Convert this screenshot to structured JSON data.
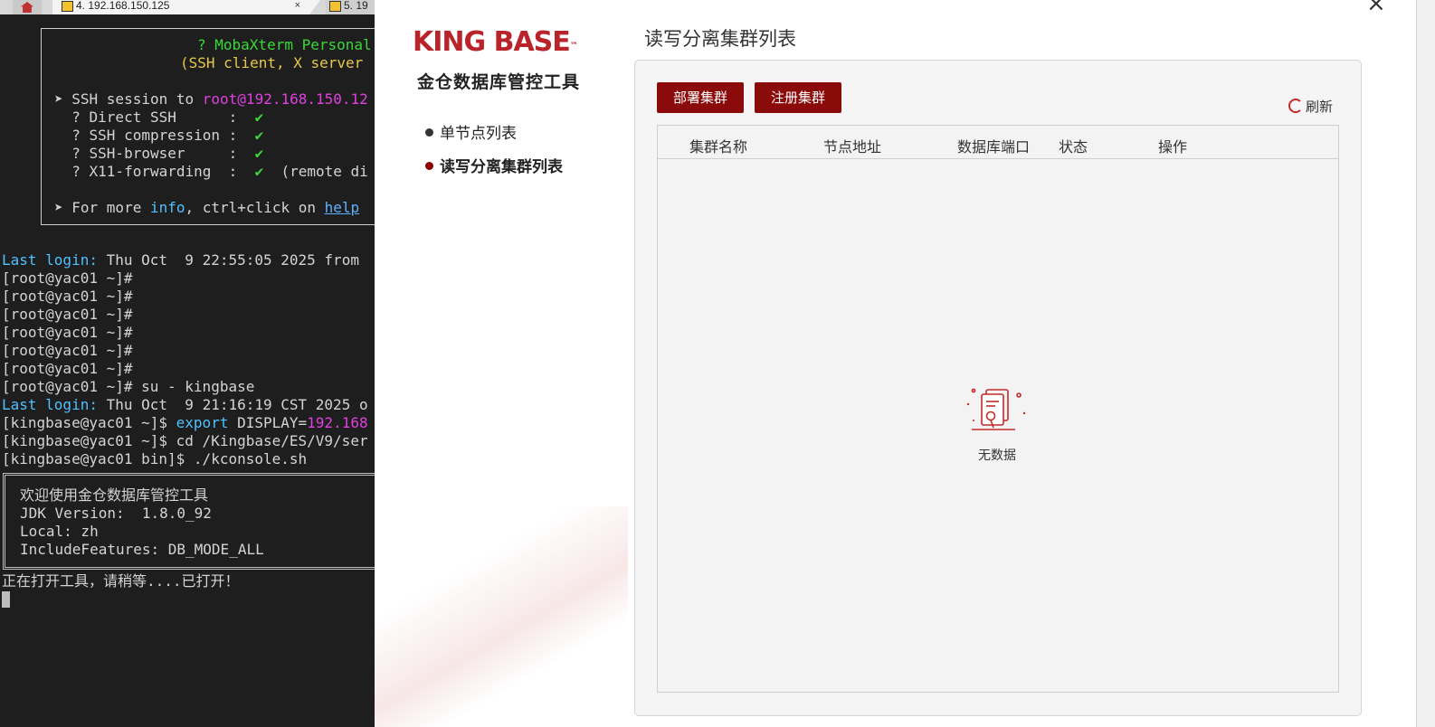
{
  "tabs": {
    "tab4_label": "4. 192.168.150.125",
    "tab5_label": "5. 19",
    "close_glyph": "×"
  },
  "terminal": {
    "welcome": {
      "line1": "? MobaXterm Personal",
      "line2": "(SSH client, X server",
      "ssh_prefix": "➤ SSH session to ",
      "ssh_host": "root@192.168.150.12",
      "direct_ssh": "  ? Direct SSH      :  ",
      "compression": "  ? SSH compression :  ",
      "browser": "  ? SSH-browser     :  ",
      "x11": "  ? X11-forwarding  :  ",
      "check": "✔",
      "x11_suffix": "  (remote di",
      "info_prefix": "➤ For more ",
      "info_word": "info",
      "info_mid": ", ctrl+click on ",
      "help_word": "help"
    },
    "last_login1_label": "Last login:",
    "last_login1_rest": " Thu Oct  9 22:55:05 2025 from",
    "prompt_root": "[root@yac01 ~]#",
    "su_cmd": "[root@yac01 ~]# su - kingbase",
    "last_login2_label": "Last login:",
    "last_login2_rest": " Thu Oct  9 21:16:19 CST 2025 o",
    "kb_prompt": "[kingbase@yac01 ~]$ ",
    "export_kw": "export",
    "export_var": " DISPLAY=",
    "export_val": "192.168",
    "cd_cmd": "[kingbase@yac01 ~]$ cd /Kingbase/ES/V9/ser",
    "run_cmd": "[kingbase@yac01 bin]$ ./kconsole.sh",
    "kc_welcome": "欢迎使用金仓数据库管控工具",
    "kc_jdk": "JDK Version:  1.8.0_92",
    "kc_local": "Local: zh",
    "kc_features": "IncludeFeatures: DB_MODE_ALL",
    "opening": "正在打开工具，请稍等....已打开！"
  },
  "app": {
    "logo": "KING BASE",
    "logo_tm": "™",
    "subtitle": "金仓数据库管控工具",
    "nav": [
      {
        "label": "单节点列表"
      },
      {
        "label": "读写分离集群列表"
      }
    ],
    "page_title": "读写分离集群列表",
    "close": "×",
    "buttons": {
      "deploy": "部署集群",
      "register": "注册集群"
    },
    "refresh": "刷新",
    "table": {
      "columns": [
        "集群名称",
        "节点地址",
        "数据库端口",
        "状态",
        "操作"
      ],
      "empty_text": "无数据"
    },
    "colors": {
      "brand_red": "#b9232a",
      "button_red": "#8b0a0a"
    }
  }
}
